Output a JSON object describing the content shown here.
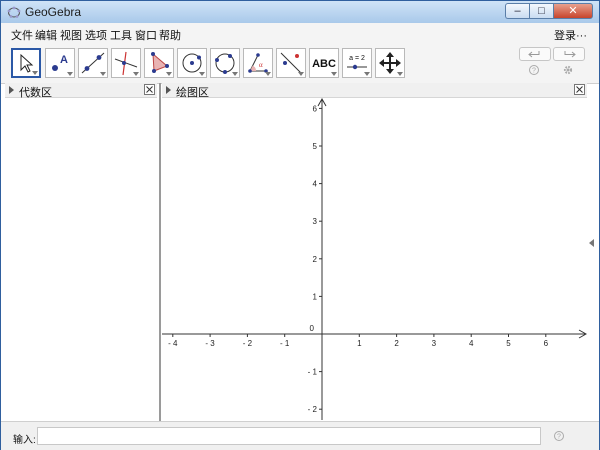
{
  "window": {
    "title": "GeoGebra"
  },
  "menu": {
    "items": [
      "文件",
      "编辑",
      "视图",
      "选项",
      "工具",
      "窗口",
      "帮助"
    ],
    "login": "登录···"
  },
  "toolbar": {
    "tools": [
      {
        "name": "move-tool",
        "icon": "arrow-pointer-icon"
      },
      {
        "name": "point-tool",
        "icon": "point-icon",
        "label": "A"
      },
      {
        "name": "line-tool",
        "icon": "line-through-two-points-icon"
      },
      {
        "name": "perpendicular-line-tool",
        "icon": "perpendicular-line-icon"
      },
      {
        "name": "polygon-tool",
        "icon": "polygon-icon"
      },
      {
        "name": "circle-tool",
        "icon": "circle-center-point-icon"
      },
      {
        "name": "circle-three-points-tool",
        "icon": "circle-three-points-icon"
      },
      {
        "name": "angle-tool",
        "icon": "angle-icon",
        "label": "α"
      },
      {
        "name": "reflect-tool",
        "icon": "reflect-about-line-icon"
      },
      {
        "name": "text-tool",
        "icon": "text-icon",
        "label": "ABC"
      },
      {
        "name": "slider-tool",
        "icon": "slider-icon",
        "label": "a = 2"
      },
      {
        "name": "move-graphics-tool",
        "icon": "move-graphics-view-icon"
      }
    ]
  },
  "panels": {
    "algebra_title": "代数区",
    "graphics_title": "绘图区"
  },
  "graphics": {
    "x_ticks": [
      -4,
      -3,
      -2,
      -1,
      1,
      2,
      3,
      4,
      5,
      6
    ],
    "y_ticks": [
      -2,
      -1,
      1,
      2,
      3,
      4,
      5,
      6
    ],
    "origin_label": "0"
  },
  "input_bar": {
    "label": "输入:",
    "value": "",
    "placeholder": ""
  }
}
